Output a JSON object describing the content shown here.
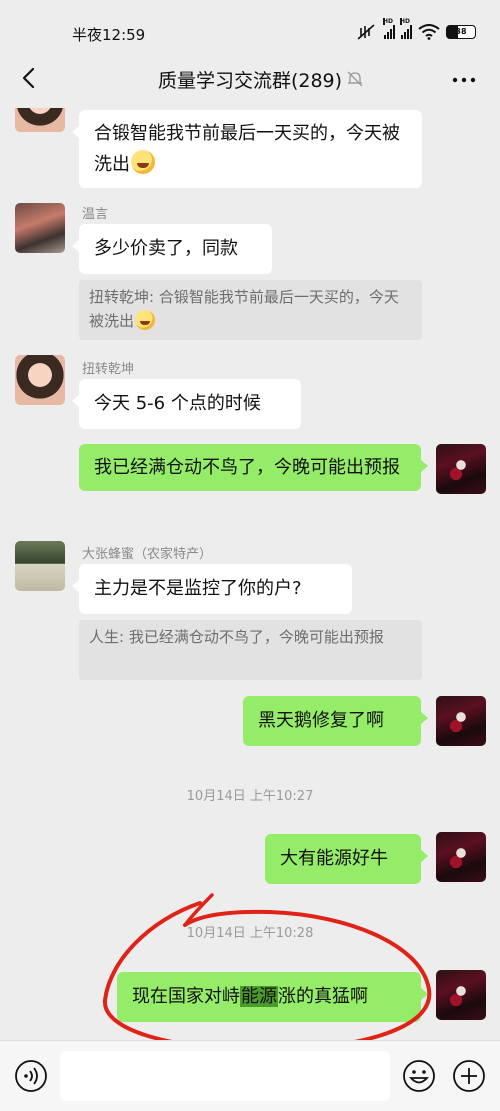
{
  "status": {
    "time": "半夜12:59",
    "battery": "38"
  },
  "nav": {
    "title": "质量学习交流群(289)"
  },
  "messages": [
    {
      "id": "m1",
      "side": "in",
      "text": "合锻智能我节前最后一天买的，今天被洗出"
    },
    {
      "id": "m2",
      "side": "in",
      "sender": "温言",
      "text": "多少价卖了，同款",
      "quote": "扭转乾坤: 合锻智能我节前最后一天买的，今天被洗出"
    },
    {
      "id": "m3",
      "side": "in",
      "sender": "扭转乾坤",
      "text": "今天 5-6 个点的时候"
    },
    {
      "id": "m4",
      "side": "out",
      "text": "我已经满仓动不鸟了，今晚可能出预报"
    },
    {
      "id": "m5",
      "side": "in",
      "sender": "大张蜂蜜（农家特产）",
      "text": "主力是不是监控了你的户?",
      "quote": "人生: 我已经满仓动不鸟了，今晚可能出预报"
    },
    {
      "id": "m6",
      "side": "out",
      "text": "黑天鹅修复了啊"
    },
    {
      "id": "t1",
      "type": "time",
      "text": "10月14日 上午10:27"
    },
    {
      "id": "m7",
      "side": "out",
      "text": "大有能源好牛"
    },
    {
      "id": "t2",
      "type": "time",
      "text": "10月14日 上午10:28"
    },
    {
      "id": "m8",
      "side": "out",
      "text_before": "现在国家对峙",
      "text_highlight": "能源",
      "text_after": "涨的真猛啊"
    }
  ],
  "annotation": {
    "color": "#e02318",
    "shape": "hand-drawn ellipse"
  },
  "input": {
    "placeholder": ""
  },
  "colors": {
    "outgoing_bubble": "#95ec69",
    "incoming_bubble": "#ffffff",
    "background": "#ededed"
  }
}
